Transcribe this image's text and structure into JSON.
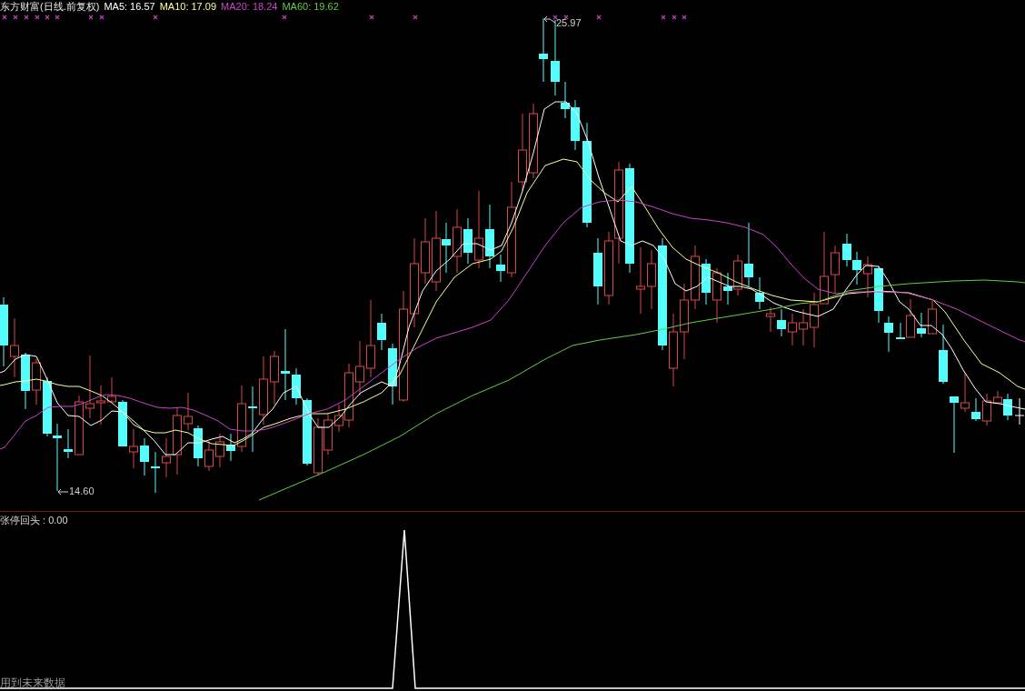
{
  "header": {
    "title": "东方财富(日线.前复权)",
    "averages": [
      {
        "label": "MA5: 16.57",
        "color": "#ffffff"
      },
      {
        "label": "MA10: 17.09",
        "color": "#ffff99"
      },
      {
        "label": "MA20: 18.24",
        "color": "#cc44cc"
      },
      {
        "label": "MA60: 19.62",
        "color": "#66cc44"
      }
    ]
  },
  "price_chart": {
    "high_label": "25.97",
    "low_label": "14.60"
  },
  "indicator_panel": {
    "label": "张停回头 : 0.00",
    "warning": "用到未来数据"
  }
}
